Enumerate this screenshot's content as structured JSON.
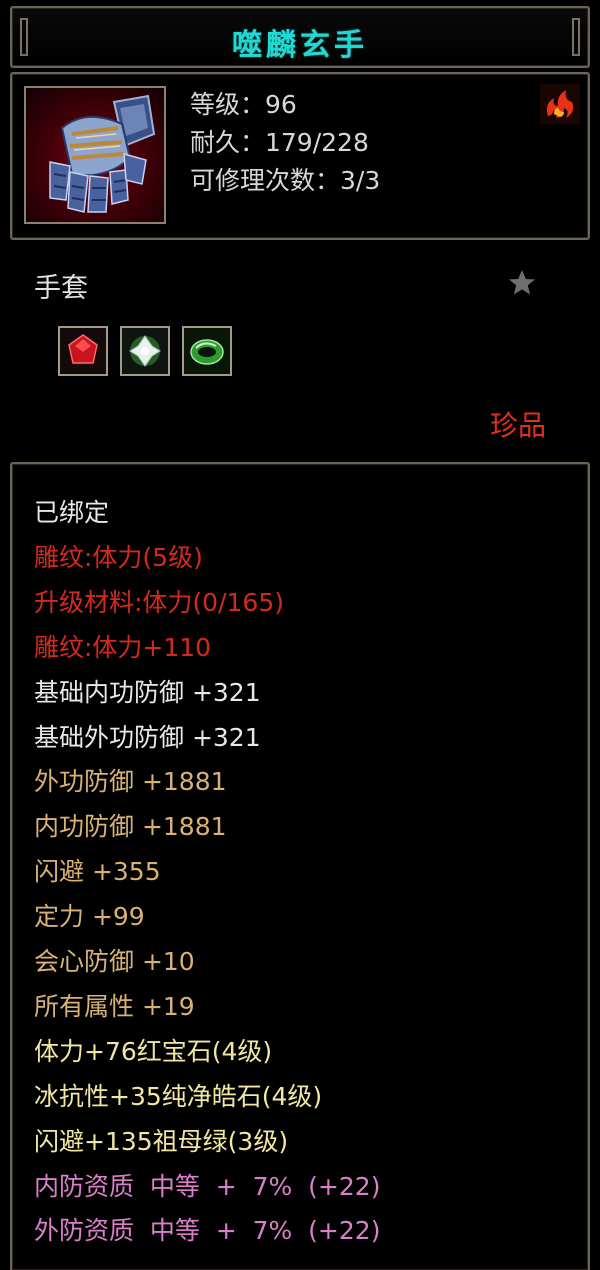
{
  "item": {
    "name": "噬麟玄手",
    "stats": {
      "level": "等级：96",
      "durability": "耐久：179/228",
      "repair_count": "可修理次数：3/3"
    },
    "type": "手套",
    "rarity": "珍品",
    "gems": [
      {
        "name": "ruby-gem-icon",
        "color": "#c8141e"
      },
      {
        "name": "diamond-gem-icon",
        "color": "#e8f0f0"
      },
      {
        "name": "emerald-gem-icon",
        "color": "#2e9a2e"
      }
    ]
  },
  "attributes": [
    {
      "text": "已绑定",
      "color": "white"
    },
    {
      "text": "雕纹:体力(5级)",
      "color": "red"
    },
    {
      "text": "升级材料:体力(0/165)",
      "color": "red"
    },
    {
      "text": "雕纹:体力+110",
      "color": "red"
    },
    {
      "text": "基础内功防御 +321",
      "color": "white"
    },
    {
      "text": "基础外功防御 +321",
      "color": "white"
    },
    {
      "text": "外功防御 +1881",
      "color": "gold"
    },
    {
      "text": "内功防御 +1881",
      "color": "gold"
    },
    {
      "text": "闪避 +355",
      "color": "gold"
    },
    {
      "text": "定力 +99",
      "color": "gold"
    },
    {
      "text": "会心防御 +10",
      "color": "gold"
    },
    {
      "text": "所有属性 +19",
      "color": "gold"
    },
    {
      "text": "体力+76红宝石(4级)",
      "color": "yellow"
    },
    {
      "text": "冰抗性+35纯净皓石(4级)",
      "color": "yellow"
    },
    {
      "text": "闪避+135祖母绿(3级)",
      "color": "yellow"
    },
    {
      "text": "内防资质  中等  +  7%  (+22)",
      "color": "pink"
    },
    {
      "text": "外防资质  中等  +  7%  (+22)",
      "color": "pink"
    }
  ]
}
